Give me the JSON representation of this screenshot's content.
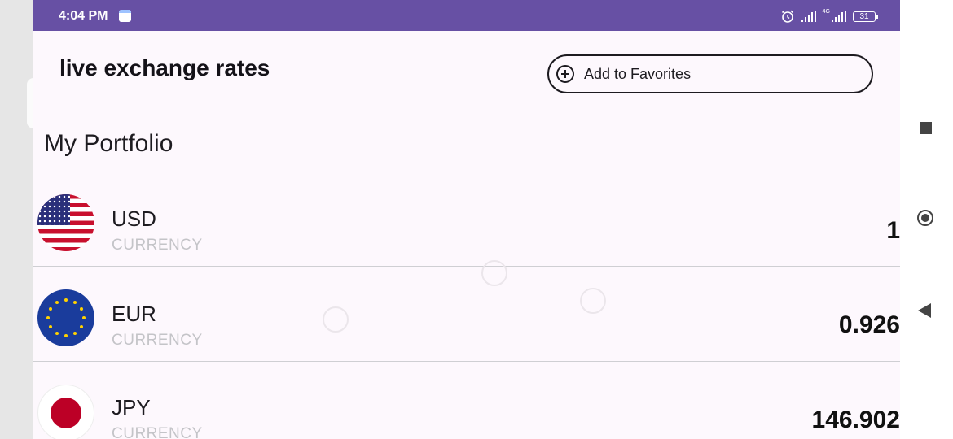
{
  "status_bar": {
    "time": "4:04 PM",
    "battery": "31"
  },
  "header": {
    "title": "live exchange rates",
    "favorites_button": {
      "label": "Add to Favorites",
      "icon": "add-circle-icon"
    }
  },
  "portfolio": {
    "title": "My Portfolio",
    "currencies": [
      {
        "code": "USD",
        "type_label": "CURRENCY",
        "value": "1",
        "flag": "us-flag-icon"
      },
      {
        "code": "EUR",
        "type_label": "CURRENCY",
        "value": "0.926",
        "flag": "eu-flag-icon"
      },
      {
        "code": "JPY",
        "type_label": "CURRENCY",
        "value": "146.902",
        "flag": "japan-flag-icon"
      }
    ]
  },
  "navigation": {
    "recents_icon": "recents-square-icon",
    "home_icon": "home-circle-icon",
    "back_icon": "back-triangle-icon"
  },
  "colors": {
    "status_bar": "#6750a4",
    "app_background": "#fdf8fd",
    "divider": "#cfcfd3",
    "secondary_text": "#c4c4c8"
  }
}
